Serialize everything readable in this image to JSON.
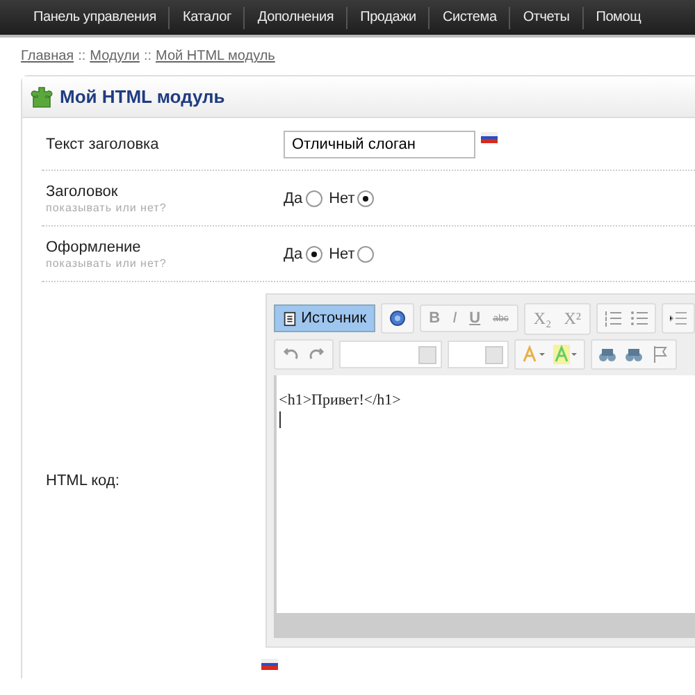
{
  "nav": [
    "Панель управления",
    "Каталог",
    "Дополнения",
    "Продажи",
    "Система",
    "Отчеты",
    "Помощ"
  ],
  "breadcrumb": [
    "Главная",
    "Модули",
    "Мой HTML модуль"
  ],
  "breadcrumb_separator": "::",
  "panel": {
    "title": "Мой HTML модуль"
  },
  "form": {
    "title_field": {
      "label": "Текст заголовка",
      "value": "Отличный слоган"
    },
    "toggles": [
      {
        "label": "Заголовок",
        "hint": "показывать или нет?",
        "options": [
          {
            "label": "Да",
            "selected": false
          },
          {
            "label": "Нет",
            "selected": true
          }
        ]
      },
      {
        "label": "Оформление",
        "hint": "показывать или нет?",
        "options": [
          {
            "label": "Да",
            "selected": true
          },
          {
            "label": "Нет",
            "selected": false
          }
        ]
      }
    ],
    "html_field": {
      "label": "HTML код:",
      "source_button": {
        "label": "Источник",
        "selected": true
      },
      "format_buttons": [
        {
          "label": "B",
          "kind": "bold"
        },
        {
          "label": "I",
          "kind": "italic"
        },
        {
          "label": "U",
          "kind": "underline"
        },
        {
          "label": "abc",
          "kind": "strike"
        },
        {
          "label": "X₂",
          "kind": "plain"
        },
        {
          "label": "X²",
          "kind": "plain"
        }
      ],
      "content": "<h1>Привет!</h1>"
    }
  }
}
